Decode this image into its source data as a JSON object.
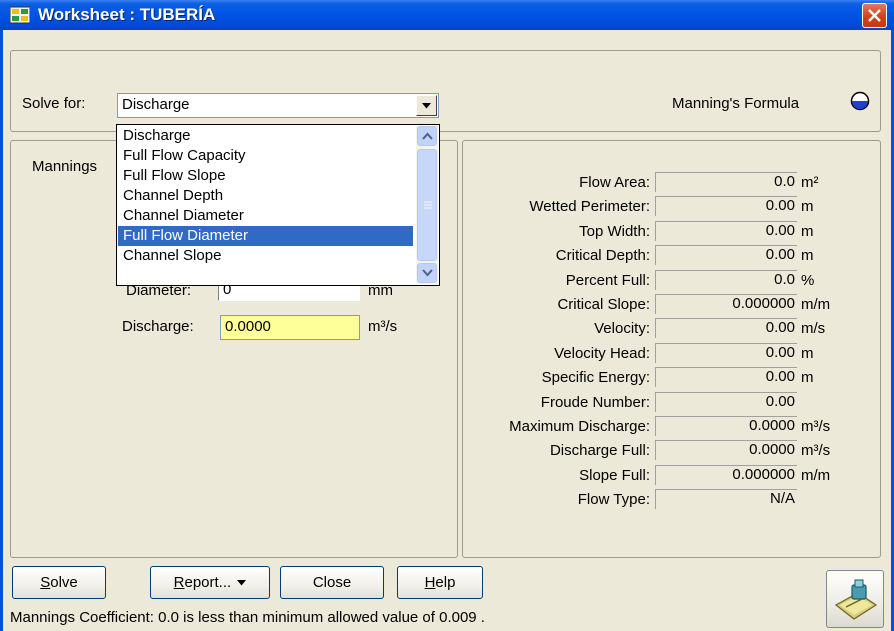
{
  "window": {
    "title": "Worksheet : TUBERÍA"
  },
  "solve": {
    "label": "Solve for:",
    "selected": "Discharge",
    "formula_label": "Manning's Formula"
  },
  "dropdown": {
    "options": [
      "Discharge",
      "Full Flow Capacity",
      "Full Flow Slope",
      "Channel Depth",
      "Channel Diameter",
      "Full Flow Diameter",
      "Channel Slope"
    ],
    "highlighted": "Full Flow Diameter"
  },
  "inputs": {
    "mannings_label_partial": "Mannings",
    "diameter_label": "Diameter:",
    "diameter_value": "0",
    "diameter_unit": "mm",
    "discharge_label": "Discharge:",
    "discharge_value": "0.0000",
    "discharge_unit": "m³/s"
  },
  "results": [
    {
      "label": "Flow Area:",
      "value": "0.0",
      "unit": "m²"
    },
    {
      "label": "Wetted Perimeter:",
      "value": "0.00",
      "unit": "m"
    },
    {
      "label": "Top Width:",
      "value": "0.00",
      "unit": "m"
    },
    {
      "label": "Critical Depth:",
      "value": "0.00",
      "unit": "m"
    },
    {
      "label": "Percent Full:",
      "value": "0.0",
      "unit": "%"
    },
    {
      "label": "Critical Slope:",
      "value": "0.000000",
      "unit": "m/m"
    },
    {
      "label": "Velocity:",
      "value": "0.00",
      "unit": "m/s"
    },
    {
      "label": "Velocity Head:",
      "value": "0.00",
      "unit": "m"
    },
    {
      "label": "Specific Energy:",
      "value": "0.00",
      "unit": "m"
    },
    {
      "label": "Froude Number:",
      "value": "0.00",
      "unit": ""
    },
    {
      "label": "Maximum Discharge:",
      "value": "0.0000",
      "unit": "m³/s"
    },
    {
      "label": "Discharge Full:",
      "value": "0.0000",
      "unit": "m³/s"
    },
    {
      "label": "Slope Full:",
      "value": "0.000000",
      "unit": "m/m"
    },
    {
      "label": "Flow Type:",
      "value": "N/A",
      "unit": ""
    }
  ],
  "buttons": {
    "solve": {
      "mnemonic": "S",
      "rest": "olve"
    },
    "report": {
      "mnemonic": "R",
      "rest": "eport..."
    },
    "close": "Close",
    "help": {
      "mnemonic": "H",
      "rest": "elp"
    }
  },
  "status": "Mannings Coefficient:  0.0  is less than minimum allowed value of 0.009 .",
  "colors": {
    "titlebar": "#0054e3",
    "selection": "#316ac5",
    "input_highlight": "#ffff99",
    "close": "#d3411a"
  }
}
